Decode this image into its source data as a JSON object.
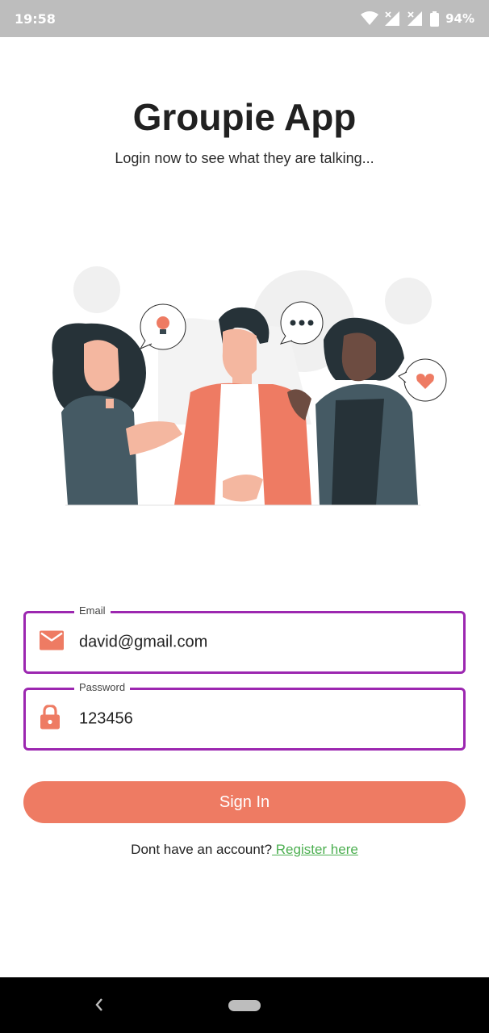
{
  "status_bar": {
    "time": "19:58",
    "battery": "94%",
    "icons": [
      "wifi-icon",
      "signal-icon",
      "signal-icon",
      "battery-icon"
    ]
  },
  "header": {
    "title": "Groupie App",
    "subtitle": "Login now to see what they are talking..."
  },
  "form": {
    "email": {
      "label": "Email",
      "value": "david@gmail.com",
      "icon": "mail-icon"
    },
    "password": {
      "label": "Password",
      "value": "123456",
      "icon": "lock-icon"
    },
    "signin_label": "Sign In",
    "register_prompt": "Dont have an account?",
    "register_link": " Register here"
  },
  "colors": {
    "accent": "#ee7b63",
    "field_border": "#9c27b0",
    "link": "#4caf50"
  },
  "nav_bar": {
    "icons": [
      "back-icon",
      "home-pill"
    ]
  }
}
